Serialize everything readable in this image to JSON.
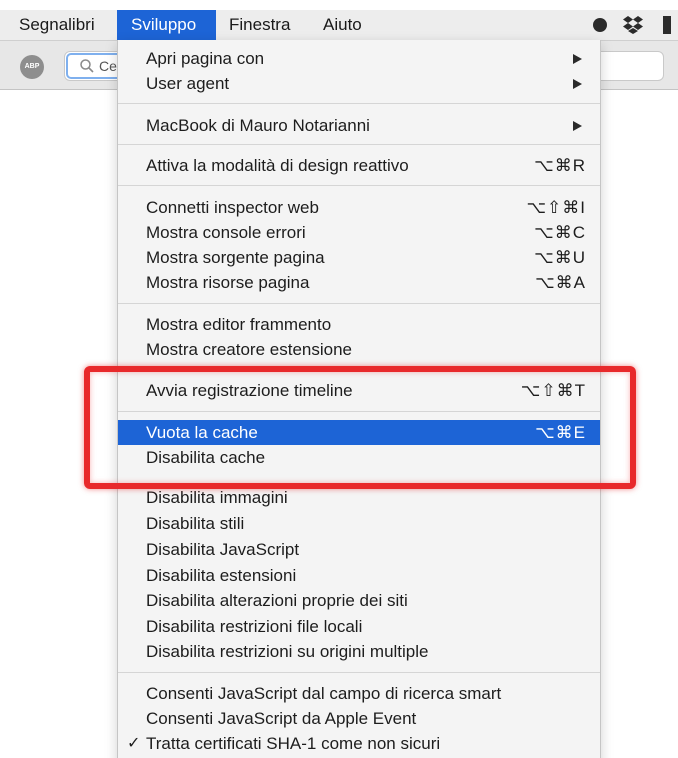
{
  "menubar": {
    "items": [
      {
        "label": "Segnalibri",
        "active": false
      },
      {
        "label": "Sviluppo",
        "active": true
      },
      {
        "label": "Finestra",
        "active": false
      },
      {
        "label": "Aiuto",
        "active": false
      }
    ],
    "tray_icons": [
      "record-dot-icon",
      "dropbox-icon",
      "battery-icon"
    ]
  },
  "toolbar": {
    "adblock_label": "ABP",
    "search_typed": "Ce"
  },
  "menu": {
    "items": [
      {
        "label": "Apri pagina con",
        "submenu": true
      },
      {
        "label": "User agent",
        "submenu": true
      },
      {
        "label": "MacBook di Mauro Notarianni",
        "submenu": true
      },
      {
        "label": "Attiva la modalità di design reattivo",
        "shortcut": "⌥⌘R"
      },
      {
        "label": "Connetti inspector web",
        "shortcut": "⌥⇧⌘I"
      },
      {
        "label": "Mostra console errori",
        "shortcut": "⌥⌘C"
      },
      {
        "label": "Mostra sorgente pagina",
        "shortcut": "⌥⌘U"
      },
      {
        "label": "Mostra risorse pagina",
        "shortcut": "⌥⌘A"
      },
      {
        "label": "Mostra editor frammento"
      },
      {
        "label": "Mostra creatore estensione"
      },
      {
        "label": "Avvia registrazione timeline",
        "shortcut": "⌥⇧⌘T"
      },
      {
        "label": "Vuota la cache",
        "shortcut": "⌥⌘E",
        "highlighted": true
      },
      {
        "label": "Disabilita cache"
      },
      {
        "label": "Disabilita immagini"
      },
      {
        "label": "Disabilita stili"
      },
      {
        "label": "Disabilita JavaScript"
      },
      {
        "label": "Disabilita estensioni"
      },
      {
        "label": "Disabilita alterazioni proprie dei siti"
      },
      {
        "label": "Disabilita restrizioni file locali"
      },
      {
        "label": "Disabilita restrizioni su origini multiple"
      },
      {
        "label": "Consenti JavaScript dal campo di ricerca smart"
      },
      {
        "label": "Consenti JavaScript da Apple Event"
      },
      {
        "label": "Tratta certificati SHA-1 come non sicuri",
        "checked": true
      }
    ]
  },
  "colors": {
    "highlight": "#1d64d6",
    "annotation": "#e8292b"
  }
}
